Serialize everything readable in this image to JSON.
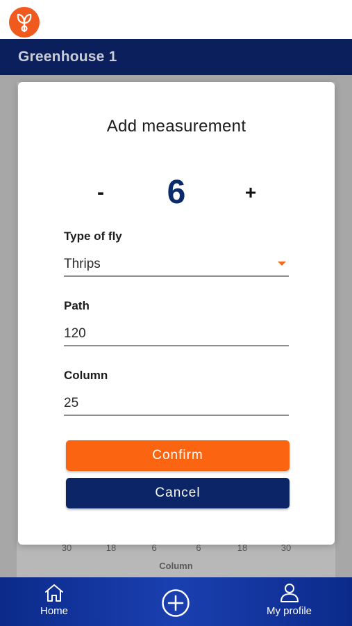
{
  "header": {
    "title": "Greenhouse 1"
  },
  "modal": {
    "title": "Add measurement",
    "stepper": {
      "decrement_label": "-",
      "count": "6",
      "increment_label": "+"
    },
    "fields": {
      "fly_type": {
        "label": "Type of fly",
        "value": "Thrips"
      },
      "path": {
        "label": "Path",
        "value": "120"
      },
      "column": {
        "label": "Column",
        "value": "25"
      }
    },
    "confirm_label": "Confirm",
    "cancel_label": "Cancel"
  },
  "background_chart": {
    "x_ticks": [
      "30",
      "18",
      "6",
      "6",
      "18",
      "30"
    ],
    "x_title": "Column"
  },
  "bottom_nav": {
    "home_label": "Home",
    "profile_label": "My profile"
  },
  "colors": {
    "brand_orange": "#fb6410",
    "navy": "#0b2566",
    "header_bg": "#0b1f5c"
  },
  "icons": {
    "logo": "sprout-icon",
    "home": "home-icon",
    "add": "plus-circle-icon",
    "profile": "user-icon",
    "dropdown": "caret-down-icon"
  }
}
